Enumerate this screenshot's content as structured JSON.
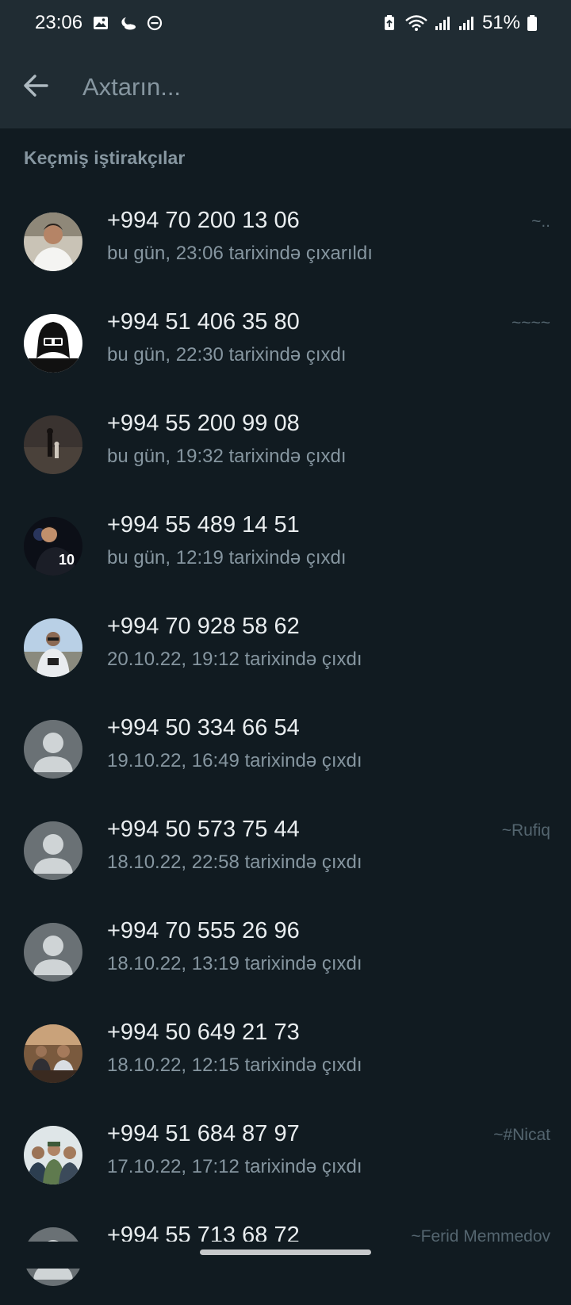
{
  "status_bar": {
    "time": "23:06",
    "battery": "51%"
  },
  "search": {
    "placeholder": "Axtarın..."
  },
  "section": {
    "title": "Keçmiş iştirakçılar"
  },
  "participants": [
    {
      "phone": "+994 70 200 13 06",
      "status": "bu gün, 23:06 tarixində çıxarıldı",
      "pushname": "~..",
      "avatar": "photo-man-white-shirt"
    },
    {
      "phone": "+994 51 406 35 80",
      "status": "bu gün, 22:30 tarixində çıxdı",
      "pushname": "~~~~",
      "avatar": "hacker-graphic"
    },
    {
      "phone": "+994 55 200 99 08",
      "status": "bu gün, 19:32 tarixində çıxdı",
      "pushname": "",
      "avatar": "photo-dark-figures"
    },
    {
      "phone": "+994 55 489 14 51",
      "status": "bu gün, 12:19 tarixində çıxdı",
      "pushname": "",
      "avatar": "photo-footballer-10"
    },
    {
      "phone": "+994 70 928 58 62",
      "status": "20.10.22, 19:12 tarixində çıxdı",
      "pushname": "",
      "avatar": "photo-man-outdoor"
    },
    {
      "phone": "+994 50 334 66 54",
      "status": "19.10.22, 16:49 tarixində çıxdı",
      "pushname": "",
      "avatar": "default-person"
    },
    {
      "phone": "+994 50 573 75 44",
      "status": "18.10.22, 22:58 tarixində çıxdı",
      "pushname": "~Rufiq",
      "avatar": "default-person"
    },
    {
      "phone": "+994 70 555 26 96",
      "status": "18.10.22, 13:19 tarixində çıxdı",
      "pushname": "",
      "avatar": "default-person"
    },
    {
      "phone": "+994 50 649 21 73",
      "status": "18.10.22, 12:15 tarixində çıxdı",
      "pushname": "",
      "avatar": "photo-group-cafe"
    },
    {
      "phone": "+994 51 684 87 97",
      "status": "17.10.22, 17:12 tarixində çıxdı",
      "pushname": "~#Nicat",
      "avatar": "photo-group-men"
    },
    {
      "phone": "+994 55 713 68 72",
      "status": "",
      "pushname": "~Ferid Memmedov",
      "avatar": "default-person"
    }
  ],
  "colors": {
    "background": "#111b21",
    "header": "#202c33",
    "primary_text": "#e9edef",
    "secondary_text": "#8696a0",
    "default_avatar": "#6a7175"
  }
}
